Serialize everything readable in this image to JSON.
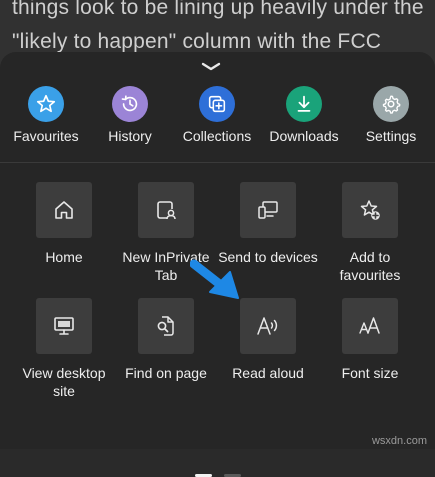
{
  "article": {
    "line1": "things look to be lining up heavily under the",
    "line2": "\"likely to happen\" column with the FCC"
  },
  "top_actions": [
    {
      "label": "Favourites",
      "icon": "star-icon",
      "color": "#3aa0e8"
    },
    {
      "label": "History",
      "icon": "history-icon",
      "color": "#9b84d6"
    },
    {
      "label": "Collections",
      "icon": "collections-icon",
      "color": "#2e6fd8"
    },
    {
      "label": "Downloads",
      "icon": "download-icon",
      "color": "#1aa37a"
    },
    {
      "label": "Settings",
      "icon": "gear-icon",
      "color": "#9aa7a9"
    }
  ],
  "tiles": [
    {
      "label": "Home",
      "icon": "home-icon"
    },
    {
      "label": "New InPrivate Tab",
      "icon": "inprivate-tab-icon"
    },
    {
      "label": "Send to devices",
      "icon": "send-to-devices-icon"
    },
    {
      "label": "Add to favourites",
      "icon": "add-favourite-icon"
    },
    {
      "label": "View desktop site",
      "icon": "desktop-site-icon"
    },
    {
      "label": "Find on page",
      "icon": "find-on-page-icon"
    },
    {
      "label": "Read aloud",
      "icon": "read-aloud-icon"
    },
    {
      "label": "Font size",
      "icon": "font-size-icon"
    }
  ],
  "pager": {
    "pages": 2,
    "current": 1
  },
  "watermark": "wsxdn.com",
  "colors": {
    "sheet": "#262626",
    "tile": "#3d3d3d",
    "arrow": "#1e88e5"
  }
}
